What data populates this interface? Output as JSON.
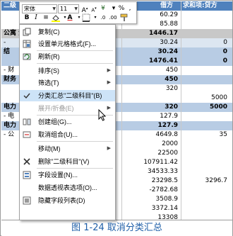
{
  "sheet": {
    "header": {
      "col_a": "二级",
      "col_c": "借方",
      "col_d": "求和项:贷方"
    },
    "rows": [
      {
        "a": "",
        "c": "60.29",
        "d": ""
      },
      {
        "a": "",
        "c": "85.88",
        "d": ""
      },
      {
        "a": "公寓 汇总",
        "c": "1446.17",
        "d": ""
      },
      {
        "a": "-",
        "c": "30.24",
        "d": "0"
      },
      {
        "a": "结",
        "c": "30.24",
        "d": "0"
      },
      {
        "a": "",
        "c": "1476.41",
        "d": "0"
      },
      {
        "a": "- 财",
        "c": "450",
        "d": ""
      },
      {
        "a": "财务",
        "c": "450",
        "d": ""
      },
      {
        "a": "",
        "c": "320",
        "d": ""
      },
      {
        "a": "",
        "c": "",
        "d": "5000"
      },
      {
        "a": "电力",
        "c": "320",
        "d": "5000"
      },
      {
        "a": "- 电",
        "c": "127.9",
        "d": ""
      },
      {
        "a": "电力",
        "c": "127.9",
        "d": ""
      },
      {
        "a": "- 公",
        "c": "4649.8",
        "d": "35"
      },
      {
        "a": "",
        "c": "2000",
        "d": ""
      },
      {
        "a": "",
        "c": "22500",
        "d": ""
      },
      {
        "a": "",
        "c": "107911.42",
        "d": ""
      },
      {
        "a": "",
        "c": "34533.33",
        "d": ""
      },
      {
        "a": "",
        "c": "23298.5",
        "d": "3296.7"
      },
      {
        "a": "",
        "c": "-2782.68",
        "d": ""
      },
      {
        "a": "",
        "c": "3508.9",
        "d": ""
      },
      {
        "a": "",
        "c": "3372.14",
        "d": ""
      },
      {
        "a": "",
        "c": "13308",
        "d": ""
      }
    ]
  },
  "mini_toolbar": {
    "font_name": "宋体",
    "font_size": "11",
    "bold": "B",
    "italic": "I",
    "currency": "¥",
    "percent": "%",
    "comma": ","
  },
  "menu": {
    "items": [
      {
        "label": "复制(C)",
        "icon": "copy-icon",
        "arrow": false,
        "disabled": false,
        "checked": false
      },
      {
        "label": "设置单元格格式(F)...",
        "icon": "format-cells-icon",
        "arrow": false,
        "disabled": false,
        "checked": false
      },
      {
        "label": "刷新(R)",
        "icon": "refresh-icon",
        "arrow": false,
        "disabled": false,
        "checked": false
      },
      {
        "label": "排序(S)",
        "icon": "",
        "arrow": true,
        "disabled": false,
        "checked": false
      },
      {
        "label": "筛选(T)",
        "icon": "",
        "arrow": true,
        "disabled": false,
        "checked": false
      },
      {
        "label": "分类汇总\"二级科目\"(B)",
        "icon": "checkmark-icon",
        "arrow": false,
        "disabled": false,
        "checked": true
      },
      {
        "label": "展开/折叠(E)",
        "icon": "",
        "arrow": true,
        "disabled": true,
        "checked": false
      },
      {
        "label": "创建组(G)...",
        "icon": "group-icon",
        "arrow": false,
        "disabled": false,
        "checked": false
      },
      {
        "label": "取消组合(U)...",
        "icon": "ungroup-icon",
        "arrow": false,
        "disabled": false,
        "checked": false
      },
      {
        "label": "移动(M)",
        "icon": "",
        "arrow": true,
        "disabled": false,
        "checked": false
      },
      {
        "label": "删除\"二级科目\"(V)",
        "icon": "delete-x-icon",
        "arrow": false,
        "disabled": false,
        "checked": false
      },
      {
        "label": "字段设置(N)...",
        "icon": "field-settings-icon",
        "arrow": false,
        "disabled": false,
        "checked": false
      },
      {
        "label": "数据透视表选项(O)...",
        "icon": "",
        "arrow": false,
        "disabled": false,
        "checked": false
      },
      {
        "label": "隐藏字段列表(D)",
        "icon": "field-list-icon",
        "arrow": false,
        "disabled": false,
        "checked": false
      }
    ]
  },
  "caption": "图 1-24 取消分类汇总",
  "colors": {
    "header_blue": "#4f81bd",
    "light_blue": "#dce6f1",
    "mid_blue": "#b8cce4",
    "caption": "#1f5fa8"
  }
}
